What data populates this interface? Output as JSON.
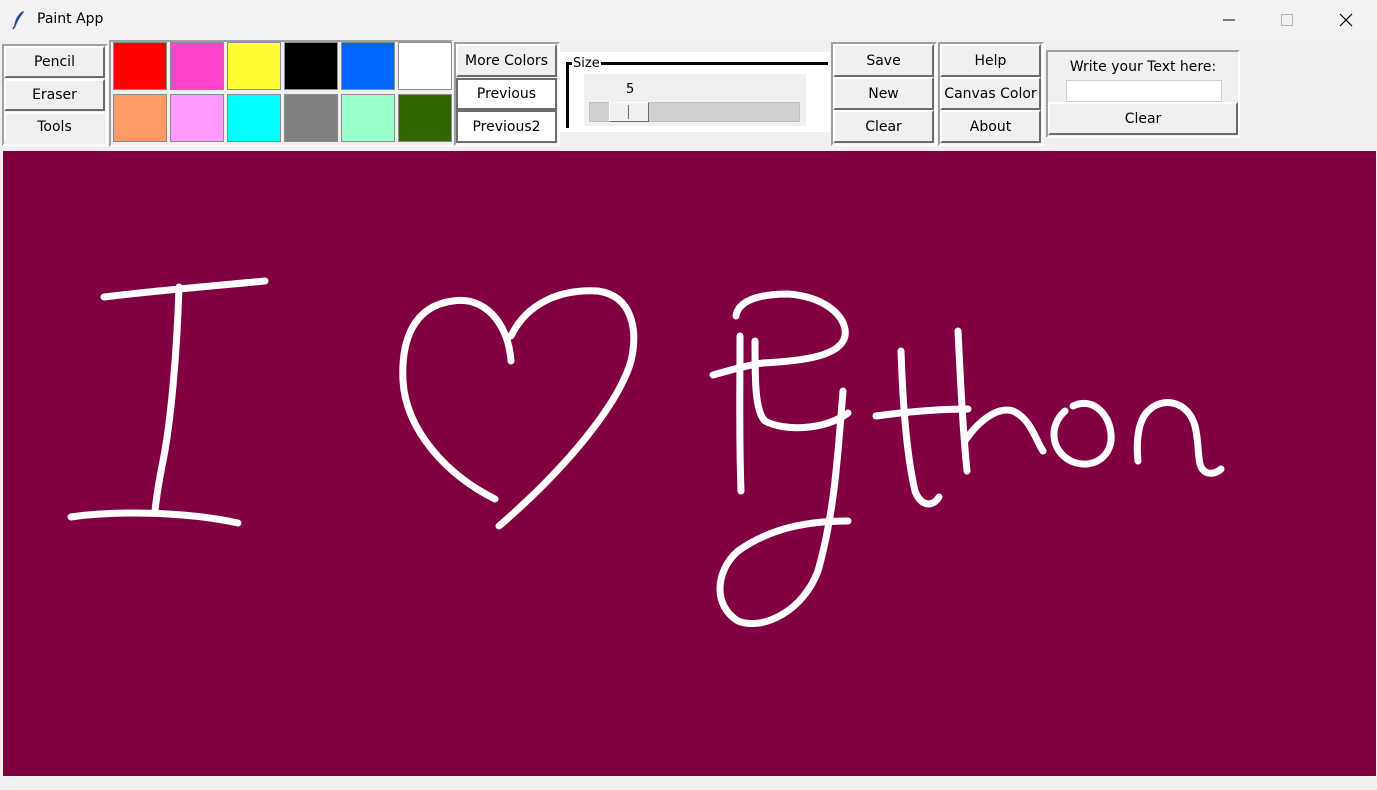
{
  "window": {
    "title": "Paint App"
  },
  "tools": {
    "pencil": "Pencil",
    "eraser": "Eraser",
    "tools": "Tools"
  },
  "palette": {
    "colors": [
      "#ff0000",
      "#ff44cc",
      "#ffff33",
      "#000000",
      "#0066ff",
      "#ffffff",
      "#ff9966",
      "#ff99ff",
      "#00ffff",
      "#808080",
      "#99ffcc",
      "#336600"
    ]
  },
  "color_buttons": {
    "more": "More Colors",
    "previous": "Previous",
    "previous2": "Previous2"
  },
  "size": {
    "legend": "Size",
    "value": "5"
  },
  "file_buttons": {
    "save": "Save",
    "new": "New",
    "clear": "Clear"
  },
  "help_buttons": {
    "help": "Help",
    "canvas_color": "Canvas Color",
    "about": "About"
  },
  "text_panel": {
    "label": "Write your Text here:",
    "input_value": "",
    "clear": "Clear"
  },
  "canvas": {
    "background": "#810041",
    "stroke_color": "#ffffff"
  }
}
